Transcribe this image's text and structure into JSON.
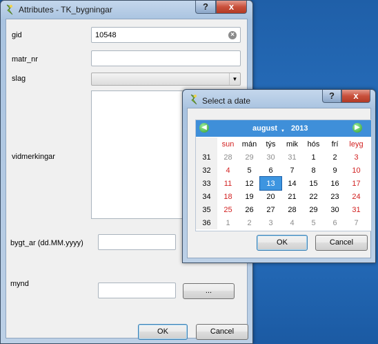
{
  "attributes_dialog": {
    "title": "Attributes - TK_bygningar",
    "help_button": "?",
    "close_button": "x",
    "fields": {
      "gid": {
        "label": "gid",
        "value": "10548"
      },
      "matr_nr": {
        "label": "matr_nr",
        "value": ""
      },
      "slag": {
        "label": "slag",
        "value": ""
      },
      "vidmerkingar": {
        "label": "vidmerkingar",
        "value": ""
      },
      "bygt_ar": {
        "label": "bygt_ar (dd.MM.yyyy)",
        "value": ""
      },
      "mynd": {
        "label": "mynd",
        "value": "",
        "browse_label": "..."
      }
    },
    "ok_label": "OK",
    "cancel_label": "Cancel"
  },
  "date_dialog": {
    "title": "Select a date",
    "help_button": "?",
    "close_button": "x",
    "calendar": {
      "month": "august",
      "year": "2013",
      "weekdays": [
        "sun",
        "mán",
        "týs",
        "mik",
        "hós",
        "frí",
        "leyg"
      ],
      "weeks": [
        {
          "week": "31",
          "days": [
            {
              "d": "28",
              "other": true
            },
            {
              "d": "29",
              "other": true
            },
            {
              "d": "30",
              "other": true
            },
            {
              "d": "31",
              "other": true
            },
            {
              "d": "1"
            },
            {
              "d": "2"
            },
            {
              "d": "3"
            }
          ]
        },
        {
          "week": "32",
          "days": [
            {
              "d": "4"
            },
            {
              "d": "5"
            },
            {
              "d": "6"
            },
            {
              "d": "7"
            },
            {
              "d": "8"
            },
            {
              "d": "9"
            },
            {
              "d": "10"
            }
          ]
        },
        {
          "week": "33",
          "days": [
            {
              "d": "11"
            },
            {
              "d": "12"
            },
            {
              "d": "13",
              "selected": true
            },
            {
              "d": "14"
            },
            {
              "d": "15"
            },
            {
              "d": "16"
            },
            {
              "d": "17"
            }
          ]
        },
        {
          "week": "34",
          "days": [
            {
              "d": "18"
            },
            {
              "d": "19"
            },
            {
              "d": "20"
            },
            {
              "d": "21"
            },
            {
              "d": "22"
            },
            {
              "d": "23"
            },
            {
              "d": "24"
            }
          ]
        },
        {
          "week": "35",
          "days": [
            {
              "d": "25"
            },
            {
              "d": "26"
            },
            {
              "d": "27"
            },
            {
              "d": "28"
            },
            {
              "d": "29"
            },
            {
              "d": "30"
            },
            {
              "d": "31"
            }
          ]
        },
        {
          "week": "36",
          "days": [
            {
              "d": "1",
              "other": true
            },
            {
              "d": "2",
              "other": true
            },
            {
              "d": "3",
              "other": true
            },
            {
              "d": "4",
              "other": true
            },
            {
              "d": "5",
              "other": true
            },
            {
              "d": "6",
              "other": true
            },
            {
              "d": "7",
              "other": true
            }
          ]
        }
      ]
    },
    "ok_label": "OK",
    "cancel_label": "Cancel"
  },
  "colors": {
    "desktop": "#2a75c5",
    "weekend_text": "#d22020",
    "selected_day": "#3d95e0",
    "calendar_header": "#3f8fd9"
  },
  "icons": [
    "qgis-app-icon",
    "clear-icon",
    "chevron-down-icon",
    "arrow-left-icon",
    "arrow-right-icon"
  ]
}
